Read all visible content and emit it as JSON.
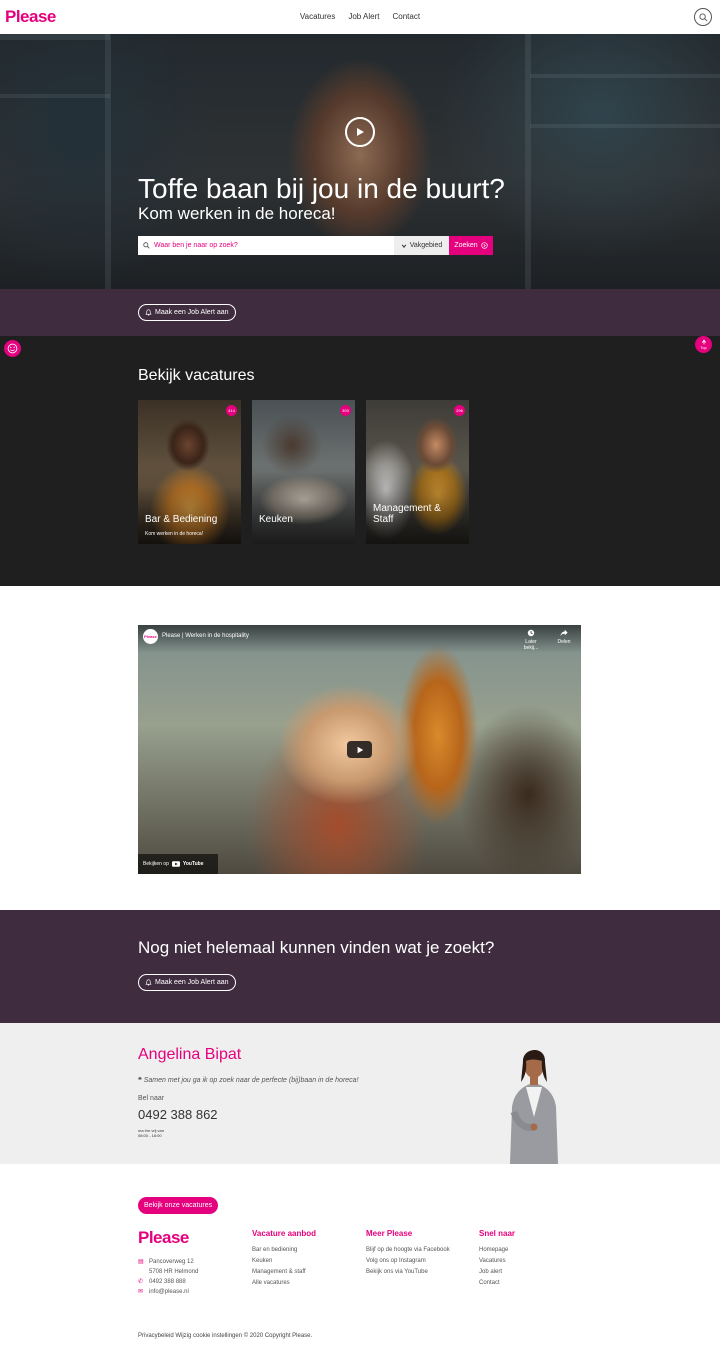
{
  "header": {
    "logo": "Please",
    "nav": [
      "Vacatures",
      "Job Alert",
      "Contact"
    ]
  },
  "hero": {
    "title": "Toffe baan bij jou in de buurt?",
    "subtitle": "Kom werken in de horeca!",
    "search_placeholder": "Waar ben je naar op zoek?",
    "vakgebied": "Vakgebied",
    "zoeken": "Zoeken"
  },
  "alert_band": {
    "button": "Maak een Job Alert aan"
  },
  "vacatures": {
    "title": "Bekijk vacatures",
    "cards": [
      {
        "title": "Bar & Bediening",
        "subtitle": "Kom werken in de horeca!",
        "count": "414"
      },
      {
        "title": "Keuken",
        "subtitle": "",
        "count": "393"
      },
      {
        "title": "Management & Staff",
        "subtitle": "",
        "count": "296"
      }
    ],
    "top_label": "Top"
  },
  "video": {
    "logo": "Please",
    "title": "Please | Werken in de hospitality",
    "later": "Later bekij...",
    "delen": "Delen",
    "watch_on": "Bekijken op",
    "youtube": "YouTube"
  },
  "not_found": {
    "title": "Nog niet helemaal kunnen vinden wat je zoekt?",
    "button": "Maak een Job Alert aan"
  },
  "contact": {
    "name": "Angelina Bipat",
    "quote": "Samen met jou ga ik op zoek naar de perfecte (bij)baan in de horeca!",
    "bel": "Bel naar",
    "phone": "0492 388 862",
    "hours_line1": "ma t/m vrij van",
    "hours_line2": "08:00 - 18:00"
  },
  "footer": {
    "cta": "Bekijk onze vacatures",
    "logo": "Please",
    "address1": "Pancoverweg 12",
    "address2": "5708 HR Helmond",
    "phone": "0492 388 888",
    "email": "info@please.nl",
    "columns": [
      {
        "title": "Vacature aanbod",
        "links": [
          "Bar en bediening",
          "Keuken",
          "Management & staff",
          "Alle vacatures"
        ]
      },
      {
        "title": "Meer Please",
        "links": [
          "Blijf op de hoogte via Facebook",
          "Volg ons op Instagram",
          "Bekijk ons via YouTube"
        ]
      },
      {
        "title": "Snel naar",
        "links": [
          "Homepage",
          "Vacatures",
          "Job alert",
          "Contact"
        ]
      }
    ],
    "copyright": "Privacybeleid Wijzig cookie instellingen © 2020 Copyright Please."
  },
  "colors": {
    "brand": "#e5007e",
    "band": "#3f2d3f",
    "dark": "#1f1f1f"
  }
}
